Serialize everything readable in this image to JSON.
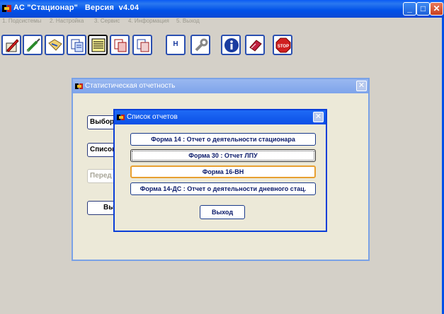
{
  "window": {
    "title": "АС \"Стационар\"   Версия  v4.04",
    "controls": [
      "_",
      "□",
      "✕"
    ]
  },
  "menu": [
    "1. Подсистемы",
    "2. Настройка",
    "3. Сервис",
    "4. Информация",
    "5. Выход"
  ],
  "toolbar": {
    "h_label": "Н",
    "buttons": [
      "edit-doc-icon",
      "syringe-icon",
      "folder-map-icon",
      "copy-pages-icon",
      "document-lines-icon",
      "red-pages-icon",
      "doc-pages-icon",
      "h-button",
      "wrench-icon",
      "info-icon",
      "book-icon",
      "stop-icon"
    ]
  },
  "stat_dialog": {
    "title": "Статистическая отчетность",
    "buttons": [
      "Выбор п",
      "Список",
      "Перед",
      "Вы"
    ]
  },
  "reports_dialog": {
    "title": "Список отчетов",
    "items": [
      "Форма 14 : Отчет о деятельности стационара",
      "Форма 30 : Отчет ЛПУ",
      "Форма 16-ВН",
      "Форма 14-ДС : Отчет о деятельности дневного стац."
    ],
    "exit": "Выход"
  },
  "colors": {
    "accent": "#0a3ed8",
    "hover": "#e8a030",
    "background": "#d4d0c8"
  }
}
